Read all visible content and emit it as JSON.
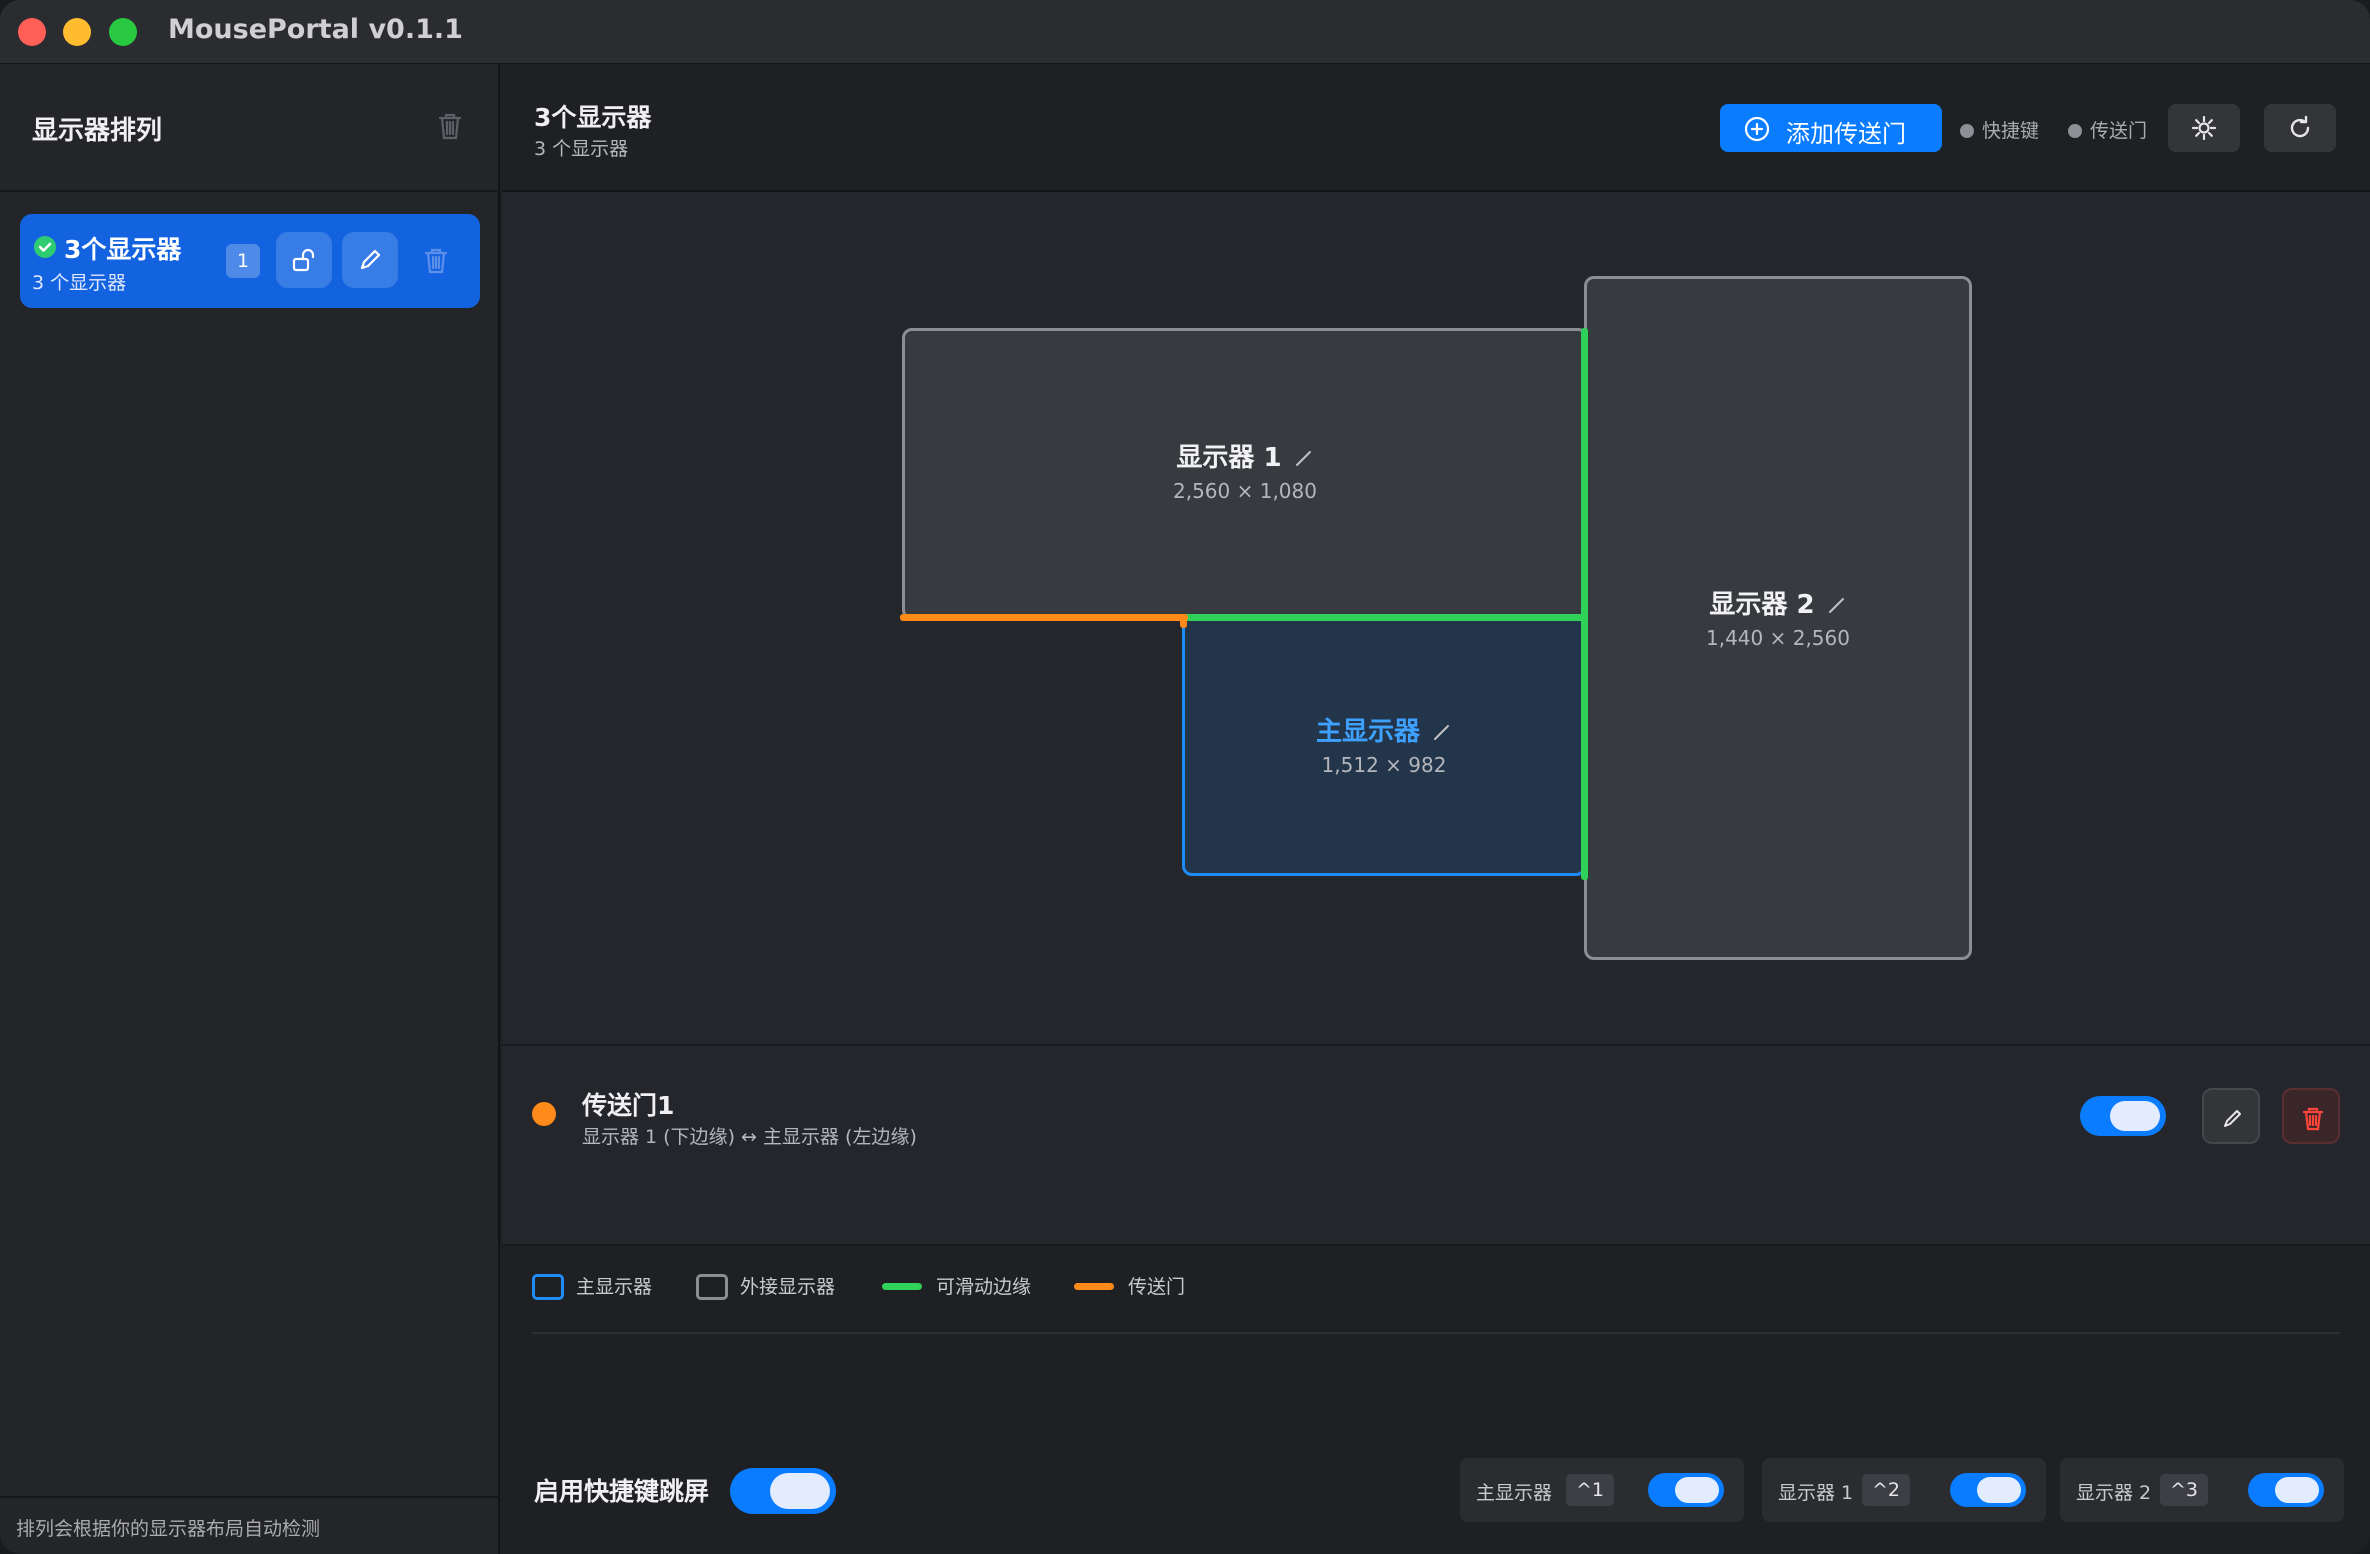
{
  "app": {
    "title": "MousePortal v0.1.1"
  },
  "sidebar": {
    "title": "显示器排列",
    "layouts": [
      {
        "name": "3个显示器",
        "subtitle": "3 个显示器",
        "badge": "1"
      }
    ],
    "footer": "排列会根据你的显示器布局自动检测"
  },
  "header": {
    "title": "3个显示器",
    "subtitle": "3 个显示器",
    "add_portal_label": "添加传送门",
    "status_hotkey": "快捷键",
    "status_portal": "传送门"
  },
  "displays": [
    {
      "name": "显示器 1",
      "resolution": "2,560 × 1,080",
      "role": "external"
    },
    {
      "name": "显示器 2",
      "resolution": "1,440 × 2,560",
      "role": "external"
    },
    {
      "name": "主显示器",
      "resolution": "1,512 × 982",
      "role": "primary"
    }
  ],
  "portals": [
    {
      "name": "传送门1",
      "description": "显示器 1 (下边缘) ↔ 主显示器 (左边缘)",
      "enabled": true,
      "color": "#ff8a1a"
    }
  ],
  "legend": {
    "primary": "主显示器",
    "external": "外接显示器",
    "slidable": "可滑动边缘",
    "portal": "传送门"
  },
  "hotkeys": {
    "label": "启用快捷键跳屏",
    "enabled": true,
    "items": [
      {
        "name": "主显示器",
        "key": "^1",
        "enabled": true
      },
      {
        "name": "显示器 1",
        "key": "^2",
        "enabled": true
      },
      {
        "name": "显示器 2",
        "key": "^3",
        "enabled": true
      }
    ]
  },
  "colors": {
    "accent": "#0a7cff",
    "slidable_edge": "#2fd158",
    "portal_edge": "#ff8a1a",
    "primary_border": "#1e8cf5",
    "danger": "#ff453a"
  }
}
